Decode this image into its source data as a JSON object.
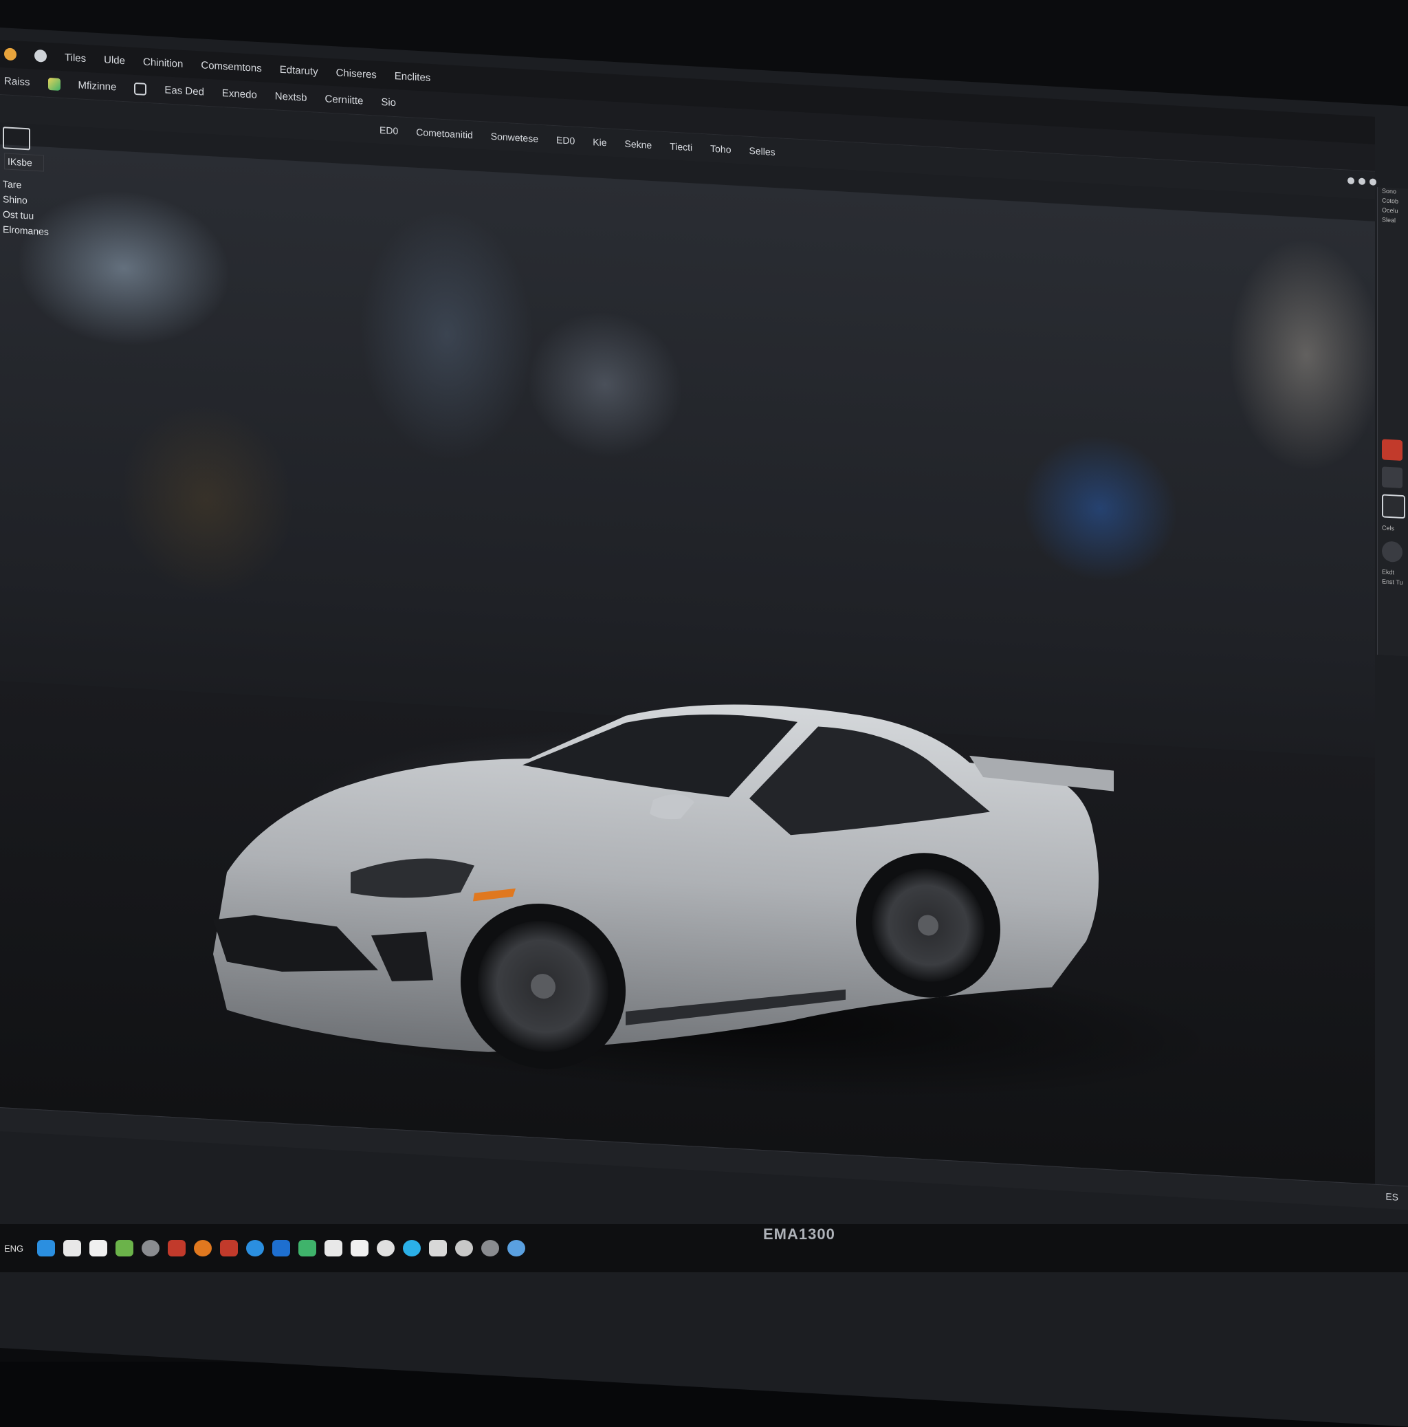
{
  "app": {
    "menu": [
      "Tiles",
      "Ulde",
      "Chinition",
      "Comsemtons",
      "Edtaruty",
      "Chiseres",
      "Enclites"
    ],
    "toolbar": [
      "Raiss",
      "Mfizinne",
      "Eas Ded",
      "Exnedo",
      "Nextsb",
      "Cerniitte",
      "Sio"
    ],
    "subbar": [
      "ED0",
      "Cometoanitid",
      "Sonwetese",
      "ED0",
      "Kie",
      "Sekne",
      "Tiecti",
      "Toho",
      "Selles"
    ]
  },
  "outliner": {
    "header": "IKsbe",
    "items": [
      "Tare",
      "Shino",
      "Ost tuu",
      "Elromanes"
    ]
  },
  "rightpanel": {
    "labels": [
      "Sono",
      "Cotob",
      "Ocelu",
      "Sleal",
      "Cels",
      "Ekdt",
      "Enst Tu"
    ]
  },
  "statusbar": {
    "right": "ES"
  },
  "taskbar": {
    "label": "ENG"
  },
  "monitor": {
    "brand": "EMA1300"
  },
  "colors": {
    "chrome": "#1c1e22",
    "car_body": "#b9bcc0",
    "accent_orange": "#e0781f",
    "accent_blue": "#2b8fe0"
  },
  "icons": [
    "app-logo-icon",
    "folder-icon",
    "file-icon",
    "chrome-icon",
    "settings-icon"
  ]
}
